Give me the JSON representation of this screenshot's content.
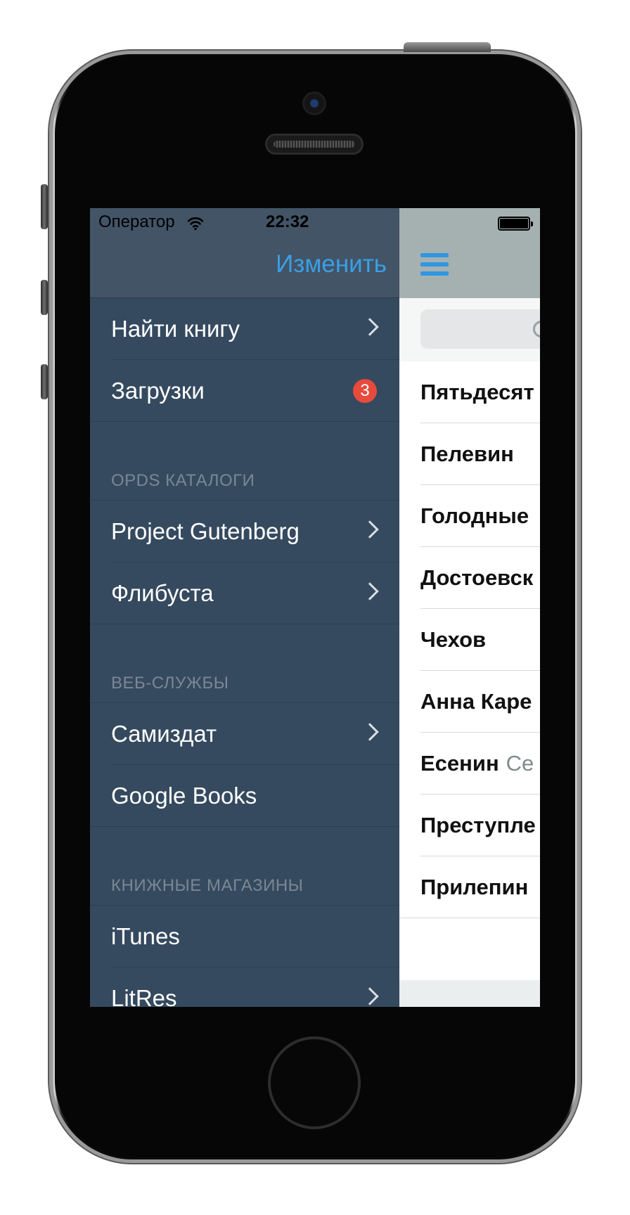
{
  "status_bar": {
    "carrier": "Оператор",
    "time": "22:32"
  },
  "menu_header": {
    "edit_label": "Изменить"
  },
  "menu": {
    "find_book": "Найти книгу",
    "downloads": "Загрузки",
    "downloads_badge": "3",
    "sections": [
      {
        "title": "OPDS КАТАЛОГИ",
        "items": [
          {
            "label": "Project Gutenberg"
          },
          {
            "label": "Флибуста"
          }
        ]
      },
      {
        "title": "ВЕБ-СЛУЖБЫ",
        "items": [
          {
            "label": "Самиздат"
          },
          {
            "label": "Google Books"
          }
        ]
      },
      {
        "title": "КНИЖНЫЕ МАГАЗИНЫ",
        "items": [
          {
            "label": "iTunes"
          },
          {
            "label": "LitRes"
          }
        ]
      }
    ]
  },
  "main_list": {
    "items": [
      {
        "title": "Пятьдесят"
      },
      {
        "title": "Пелевин"
      },
      {
        "title": "Голодные"
      },
      {
        "title": "Достоевск"
      },
      {
        "title": "Чехов"
      },
      {
        "title": "Анна Каре"
      },
      {
        "title": "Есенин",
        "subtitle": "Се"
      },
      {
        "title": "Преступле"
      },
      {
        "title": "Прилепин"
      }
    ]
  },
  "icons": {
    "wifi": "wifi-icon",
    "battery": "battery-icon",
    "menu": "hamburger-menu-icon",
    "search": "search-icon",
    "chevron": "chevron-right-icon"
  },
  "colors": {
    "menu_bg": "#354a5f",
    "menu_header_bg": "#435467",
    "accent": "#3a9fe5",
    "badge": "#e84a3c",
    "main_nav_bg": "#a5b1b1"
  }
}
